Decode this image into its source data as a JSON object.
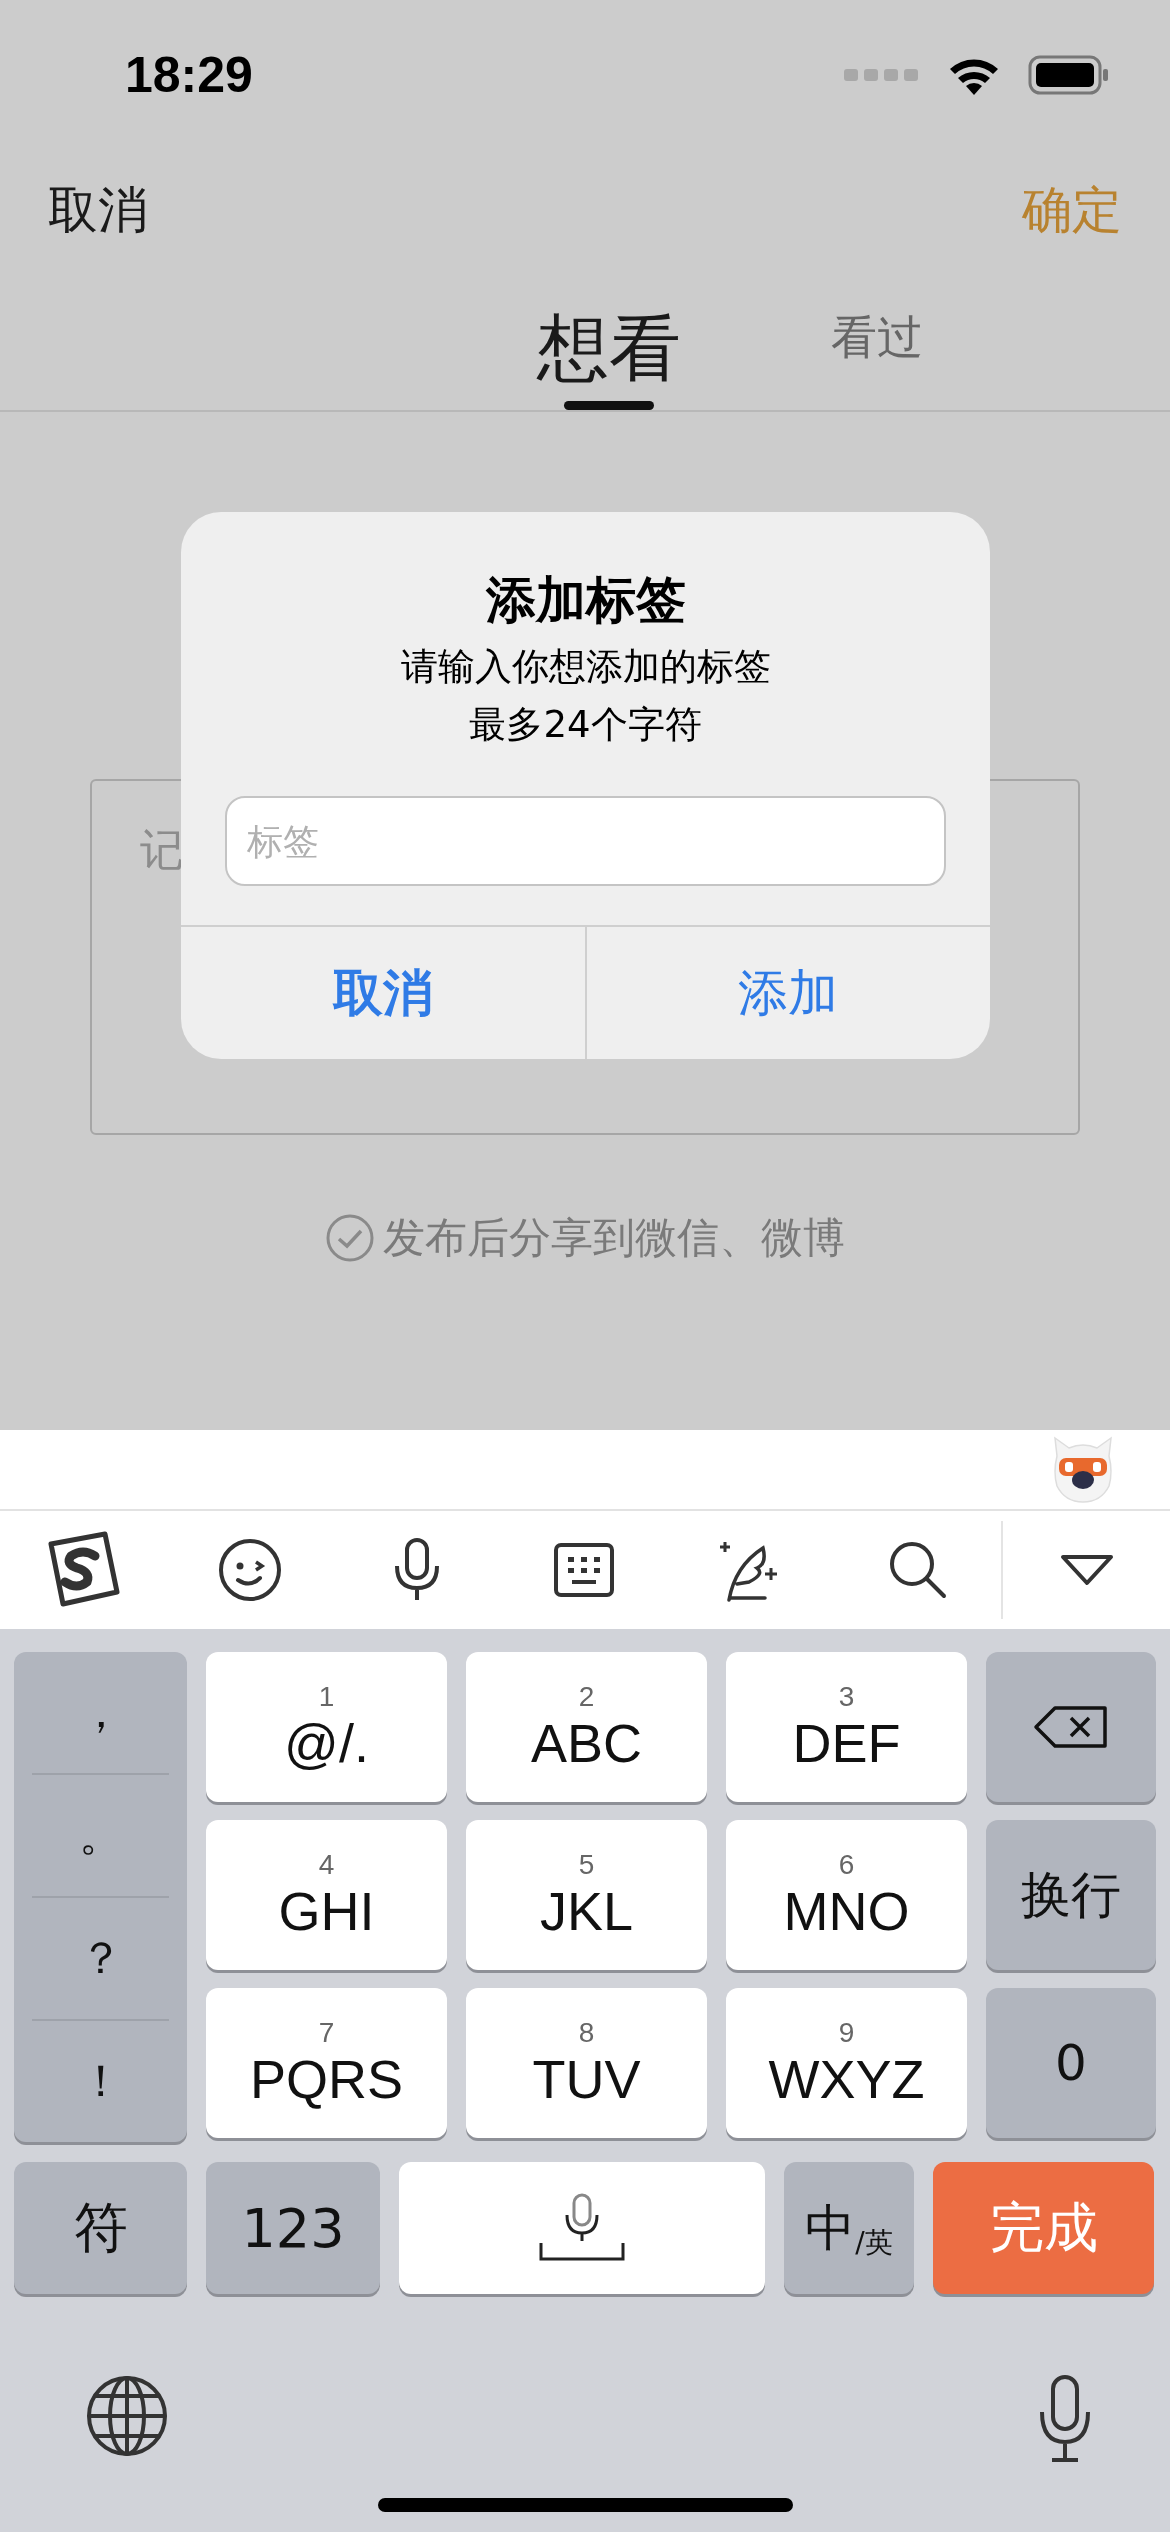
{
  "status_bar": {
    "time": "18:29"
  },
  "nav": {
    "cancel": "取消",
    "confirm": "确定"
  },
  "tabs": [
    {
      "label": "想看",
      "selected": true
    },
    {
      "label": "看过",
      "selected": false
    }
  ],
  "note_placeholder": "记",
  "share_option": {
    "label": "发布后分享到微信、微博",
    "checked": false
  },
  "dialog": {
    "title": "添加标签",
    "message": [
      "请输入你想添加的标签",
      "最多24个字符"
    ],
    "field": {
      "placeholder": "标签"
    },
    "buttons": [
      {
        "label": "取消",
        "kind": "preferred"
      },
      {
        "label": "添加",
        "kind": "normal"
      }
    ]
  },
  "keyboard": {
    "punctuation": [
      "，",
      "。",
      "？",
      "！"
    ],
    "keys": [
      {
        "digit": "1",
        "letters": "@/."
      },
      {
        "digit": "2",
        "letters": "ABC"
      },
      {
        "digit": "3",
        "letters": "DEF"
      },
      {
        "digit": "4",
        "letters": "GHI"
      },
      {
        "digit": "5",
        "letters": "JKL"
      },
      {
        "digit": "6",
        "letters": "MNO"
      },
      {
        "digit": "7",
        "letters": "PQRS"
      },
      {
        "digit": "8",
        "letters": "TUV"
      },
      {
        "digit": "9",
        "letters": "WXYZ"
      }
    ],
    "side_keys": [
      {
        "kind": "delete"
      },
      {
        "kind": "text",
        "label": "换行"
      },
      {
        "kind": "text",
        "label": "0"
      }
    ],
    "bottom_keys": [
      {
        "kind": "text",
        "label": "符"
      },
      {
        "kind": "text",
        "label": "123"
      },
      {
        "kind": "space"
      },
      {
        "kind": "lang",
        "main": "中",
        "sub": "/英"
      },
      {
        "kind": "done",
        "label": "完成"
      }
    ]
  }
}
